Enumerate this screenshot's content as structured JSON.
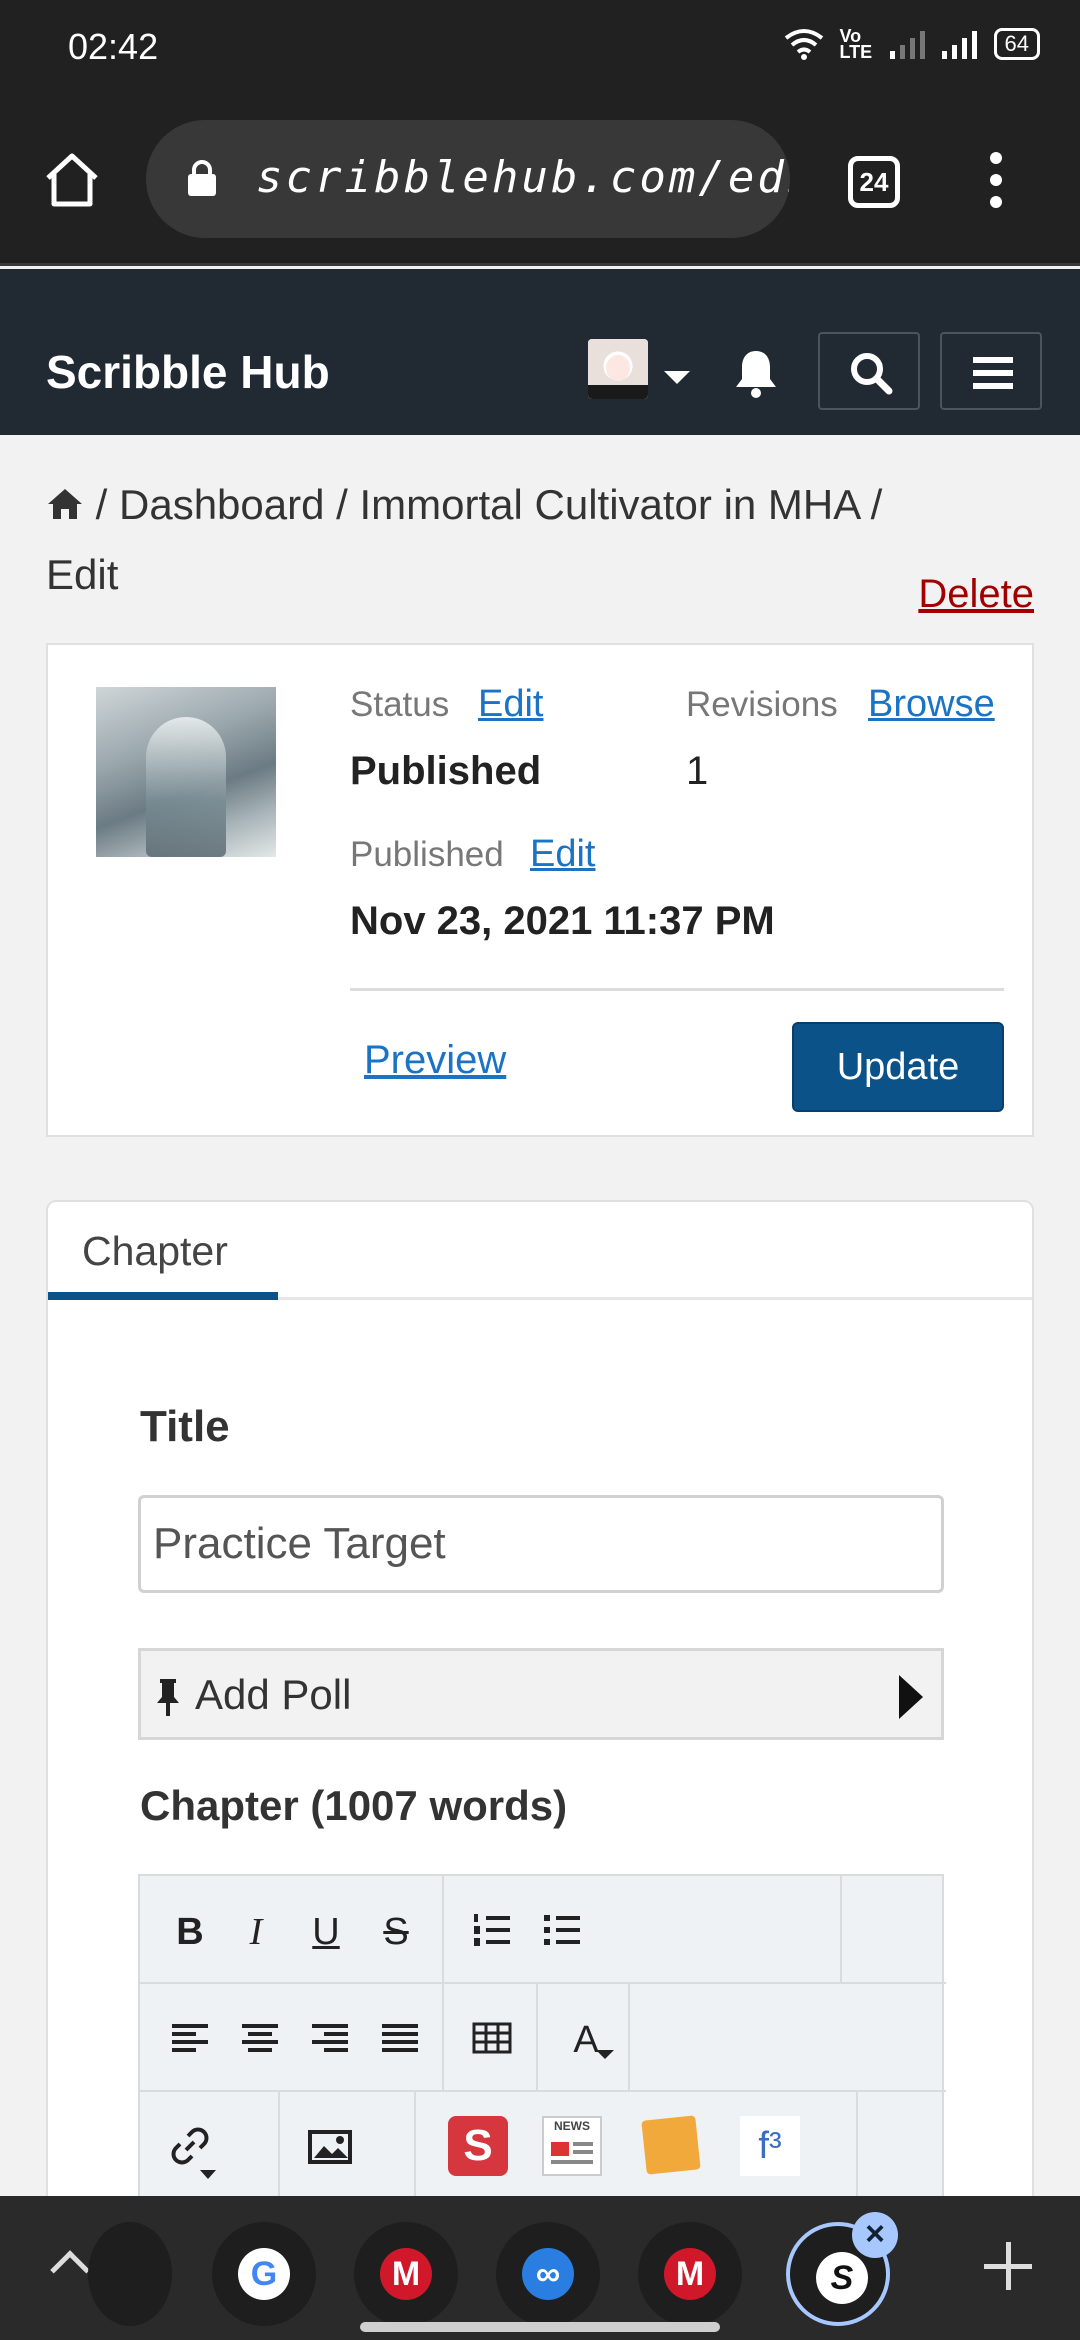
{
  "status_bar": {
    "time": "02:42",
    "volte": "Vo LTE",
    "battery": "64"
  },
  "browser": {
    "url": "scribblehub.com/editche",
    "tab_count": "24"
  },
  "site": {
    "brand": "Scribble Hub"
  },
  "breadcrumb": {
    "dashboard": "/ Dashboard",
    "series": "/ Immortal Cultivator in MHA",
    "edit": "/ Edit"
  },
  "actions": {
    "delete": "Delete",
    "preview": "Preview",
    "update": "Update"
  },
  "publish": {
    "status_label": "Status",
    "status_edit": "Edit",
    "status_value": "Published",
    "revisions_label": "Revisions",
    "revisions_browse": "Browse",
    "revisions_value": "1",
    "published_label": "Published",
    "published_edit": "Edit",
    "published_value": "Nov 23, 2021 11:37 PM"
  },
  "editor": {
    "tab": "Chapter",
    "title_label": "Title",
    "title_value": "Practice Target",
    "add_poll": "Add Poll",
    "chapter_label": "Chapter (1007 words)"
  },
  "toolbar": {
    "bold": "B",
    "italic": "I",
    "underline": "U",
    "strike": "S",
    "font_color": "A",
    "formula": "f³",
    "stamp": "S",
    "news": "NEWS"
  },
  "bottom_tabs": [
    "G",
    "M",
    "∞",
    "M",
    "S"
  ]
}
